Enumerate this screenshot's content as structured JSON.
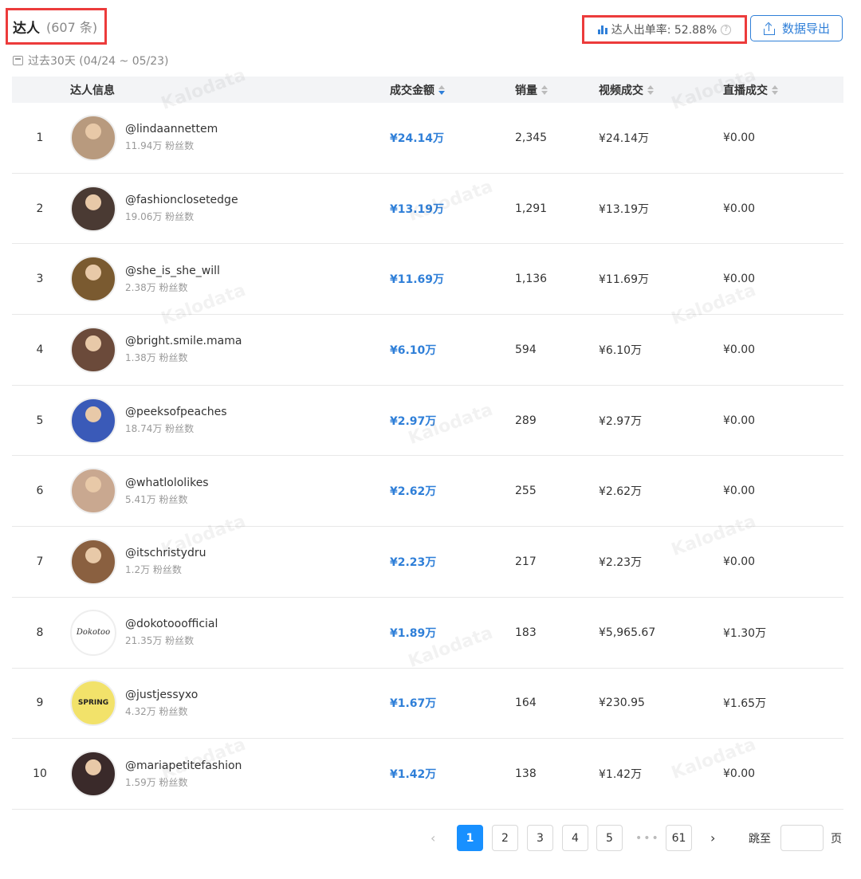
{
  "header": {
    "title": "达人",
    "count": "(607 条)",
    "date_range": "过去30天 (04/24 ~ 05/23)",
    "rate_label": "达人出单率: 52.88%",
    "help": "?",
    "export_label": "数据导出"
  },
  "table": {
    "columns": [
      "达人信息",
      "成交金额",
      "销量",
      "视频成交",
      "直播成交"
    ],
    "rows": [
      {
        "rank": "1",
        "handle": "@lindaannettem",
        "fans": "11.94万 粉丝数",
        "gmv": "¥24.14万",
        "sales": "2,345",
        "video": "¥24.14万",
        "live": "¥0.00"
      },
      {
        "rank": "2",
        "handle": "@fashionclosetedge",
        "fans": "19.06万 粉丝数",
        "gmv": "¥13.19万",
        "sales": "1,291",
        "video": "¥13.19万",
        "live": "¥0.00"
      },
      {
        "rank": "3",
        "handle": "@she_is_she_will",
        "fans": "2.38万 粉丝数",
        "gmv": "¥11.69万",
        "sales": "1,136",
        "video": "¥11.69万",
        "live": "¥0.00"
      },
      {
        "rank": "4",
        "handle": "@bright.smile.mama",
        "fans": "1.38万 粉丝数",
        "gmv": "¥6.10万",
        "sales": "594",
        "video": "¥6.10万",
        "live": "¥0.00"
      },
      {
        "rank": "5",
        "handle": "@peeksofpeaches",
        "fans": "18.74万 粉丝数",
        "gmv": "¥2.97万",
        "sales": "289",
        "video": "¥2.97万",
        "live": "¥0.00"
      },
      {
        "rank": "6",
        "handle": "@whatlololikes",
        "fans": "5.41万 粉丝数",
        "gmv": "¥2.62万",
        "sales": "255",
        "video": "¥2.62万",
        "live": "¥0.00"
      },
      {
        "rank": "7",
        "handle": "@itschristydru",
        "fans": "1.2万 粉丝数",
        "gmv": "¥2.23万",
        "sales": "217",
        "video": "¥2.23万",
        "live": "¥0.00"
      },
      {
        "rank": "8",
        "handle": "@dokotooofficial",
        "fans": "21.35万 粉丝数",
        "gmv": "¥1.89万",
        "sales": "183",
        "video": "¥5,965.67",
        "live": "¥1.30万",
        "logo_text": "Dokotoo"
      },
      {
        "rank": "9",
        "handle": "@justjessyxo",
        "fans": "4.32万 粉丝数",
        "gmv": "¥1.67万",
        "sales": "164",
        "video": "¥230.95",
        "live": "¥1.65万",
        "logo_text": "SPRING"
      },
      {
        "rank": "10",
        "handle": "@mariapetitefashion",
        "fans": "1.59万 粉丝数",
        "gmv": "¥1.42万",
        "sales": "138",
        "video": "¥1.42万",
        "live": "¥0.00"
      }
    ]
  },
  "avatar_colors": [
    "#b89a7e",
    "#4a3a33",
    "#7a5a30",
    "#6b4a3a",
    "#3a5ab8",
    "#c9a890",
    "#8a6040",
    "#ffffff",
    "#f2e26a",
    "#3a2a2a"
  ],
  "watermark": "Kalodata",
  "pagination": {
    "prev": "‹",
    "next": "›",
    "pages": [
      "1",
      "2",
      "3",
      "4",
      "5"
    ],
    "ellipsis": "•••",
    "last": "61",
    "jump_label": "跳至",
    "jump_suffix": "页"
  },
  "colors": {
    "accent": "#2f7fd8",
    "highlight": "#ec3b3b",
    "active_page": "#1890ff"
  }
}
